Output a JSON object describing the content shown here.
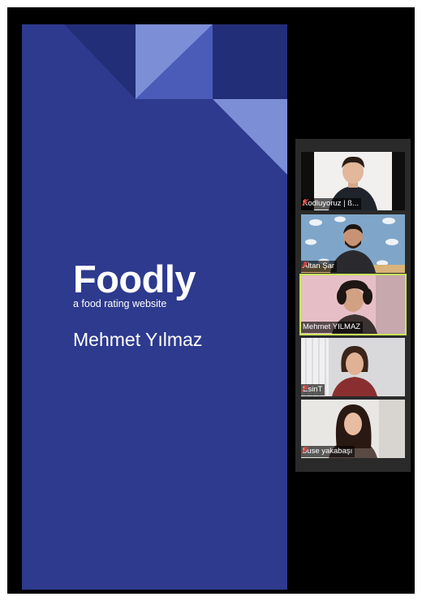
{
  "slide": {
    "logo": "Foodly",
    "tagline": "a food rating website",
    "presenter": "Mehmet Yılmaz"
  },
  "participants": [
    {
      "name": "Kodluyoruz | ß...",
      "muted": true
    },
    {
      "name": "Altan Şar",
      "muted": true
    },
    {
      "name": "Mehmet YILMAZ",
      "muted": false,
      "active_speaker": true
    },
    {
      "name": "EsinT",
      "muted": true
    },
    {
      "name": "buse yakabaşı",
      "muted": true
    }
  ],
  "colors": {
    "slide_bg": "#2d3a8e",
    "active_border": "#c9e35a",
    "muted_icon": "#e04040"
  }
}
